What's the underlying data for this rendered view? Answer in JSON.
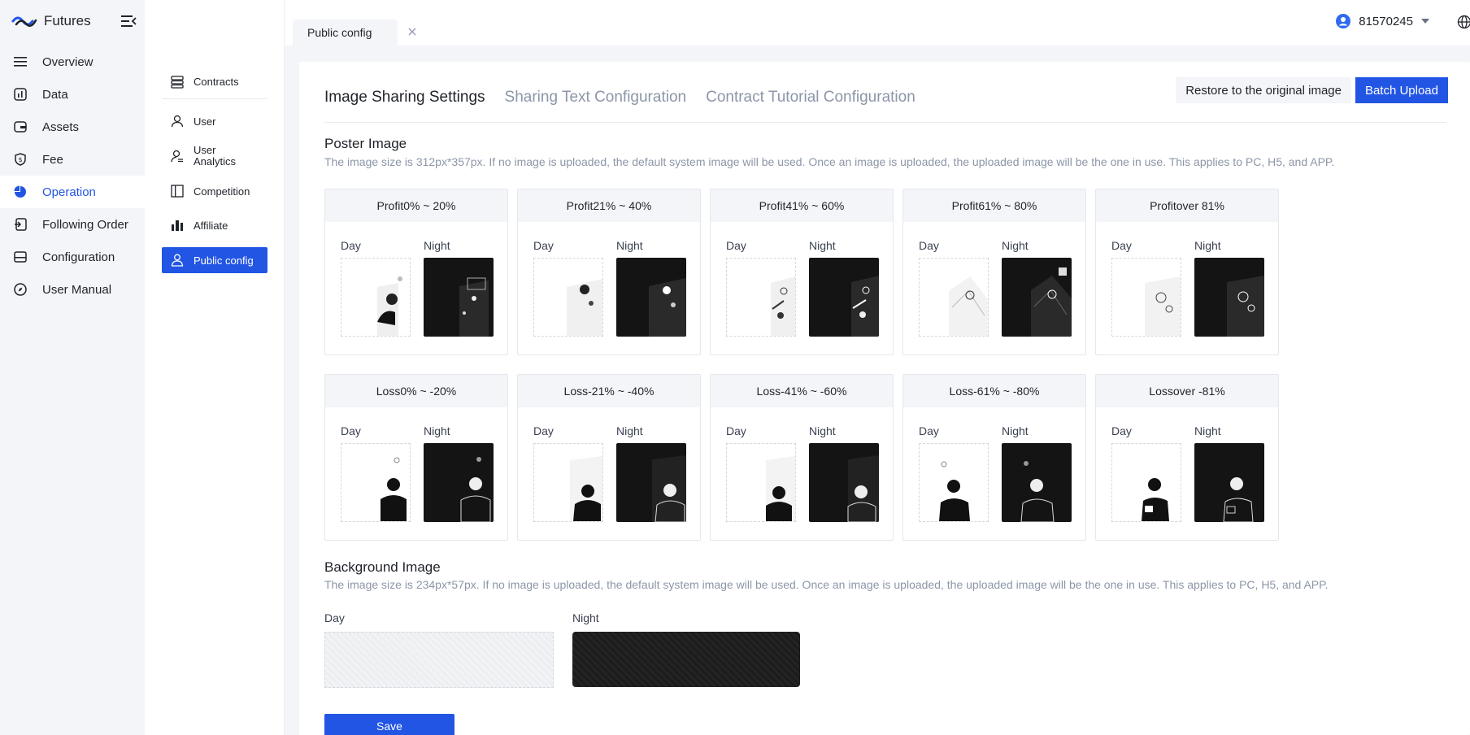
{
  "brand": {
    "name": "Futures"
  },
  "nav": [
    {
      "label": "Overview",
      "icon": "list-icon"
    },
    {
      "label": "Data",
      "icon": "chart-icon"
    },
    {
      "label": "Assets",
      "icon": "assets-icon"
    },
    {
      "label": "Fee",
      "icon": "fee-icon"
    },
    {
      "label": "Operation",
      "icon": "pie-icon",
      "active": true
    },
    {
      "label": "Following Order",
      "icon": "follow-icon"
    },
    {
      "label": "Configuration",
      "icon": "config-icon"
    },
    {
      "label": "User Manual",
      "icon": "compass-icon"
    }
  ],
  "subnav": [
    {
      "label": "Contracts",
      "icon": "contracts-icon"
    },
    {
      "label": "User",
      "icon": "user-icon"
    },
    {
      "label": "User\nAnalytics",
      "icon": "user-analytics-icon"
    },
    {
      "label": "Competition",
      "icon": "competition-icon"
    },
    {
      "label": "Affiliate",
      "icon": "affiliate-icon"
    },
    {
      "label": "Public config",
      "icon": "public-config-icon",
      "active": true
    }
  ],
  "topbar": {
    "tab_label": "Public config",
    "user_id": "81570245"
  },
  "page_tabs": [
    "Image Sharing Settings",
    "Sharing Text Configuration",
    "Contract Tutorial Configuration"
  ],
  "actions": {
    "restore": "Restore to the original image",
    "batch": "Batch Upload",
    "save": "Save"
  },
  "poster": {
    "title": "Poster Image",
    "desc": "The image size is 312px*357px. If no image is uploaded, the default system image will be used. Once an image is uploaded, the uploaded image will be the one in use. This applies to PC, H5, and APP.",
    "day_label": "Day",
    "night_label": "Night",
    "profit": [
      "Profit0% ~ 20%",
      "Profit21% ~ 40%",
      "Profit41% ~ 60%",
      "Profit61% ~ 80%",
      "Profitover 81%"
    ],
    "loss": [
      "Loss0% ~ -20%",
      "Loss-21% ~ -40%",
      "Loss-41% ~ -60%",
      "Loss-61% ~ -80%",
      "Lossover -81%"
    ]
  },
  "background": {
    "title": "Background Image",
    "desc": "The image size is 234px*57px. If no image is uploaded, the default system image will be used. Once an image is uploaded, the uploaded image will be the one in use. This applies to PC, H5, and APP.",
    "day_label": "Day",
    "night_label": "Night"
  },
  "colors": {
    "accent": "#2255e4",
    "muted": "#8c96a8",
    "sidebar_bg": "#f3f5f8"
  }
}
